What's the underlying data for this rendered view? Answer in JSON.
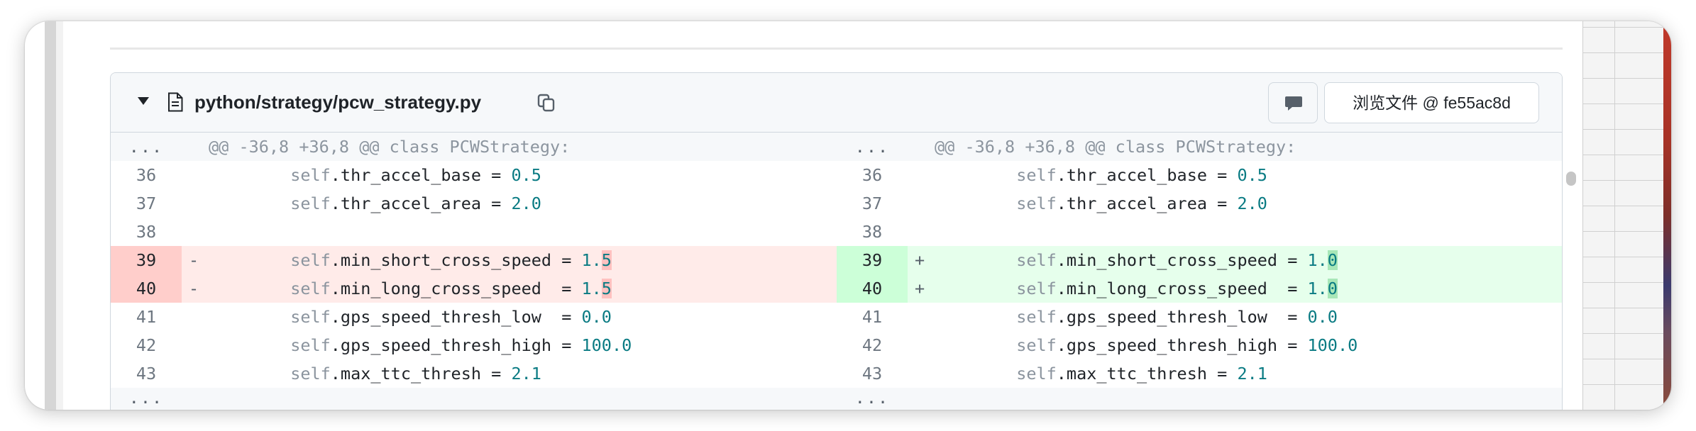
{
  "file": {
    "path": "python/strategy/pcw_strategy.py",
    "view_file_label": "浏览文件 @ fe55ac8d"
  },
  "icons": {
    "collapse": "chevron-down-icon",
    "file": "file-icon",
    "copy": "copy-icon",
    "comment": "comment-icon"
  },
  "diff": {
    "hunk_header": "@@ -36,8 +36,8 @@ class PCWStrategy:",
    "expander": "...",
    "rows": [
      {
        "type": "ctx",
        "left_num": "36",
        "right_num": "36",
        "indent": "        ",
        "self": "self",
        "attr": ".thr_accel_base = ",
        "left_val": "0.5",
        "right_val": "0.5"
      },
      {
        "type": "ctx",
        "left_num": "37",
        "right_num": "37",
        "indent": "        ",
        "self": "self",
        "attr": ".thr_accel_area = ",
        "left_val": "2.0",
        "right_val": "2.0"
      },
      {
        "type": "ctx",
        "left_num": "38",
        "right_num": "38",
        "indent": "",
        "self": "",
        "attr": "",
        "left_val": "",
        "right_val": ""
      },
      {
        "type": "change",
        "left_num": "39",
        "right_num": "39",
        "left_marker": "-",
        "right_marker": "+",
        "indent": "        ",
        "self": "self",
        "attr": ".min_short_cross_speed = ",
        "left_val_a": "1.",
        "left_val_b": "5",
        "right_val_a": "1.",
        "right_val_b": "0"
      },
      {
        "type": "change",
        "left_num": "40",
        "right_num": "40",
        "left_marker": "-",
        "right_marker": "+",
        "indent": "        ",
        "self": "self",
        "attr": ".min_long_cross_speed  = ",
        "left_val_a": "1.",
        "left_val_b": "5",
        "right_val_a": "1.",
        "right_val_b": "0"
      },
      {
        "type": "ctx",
        "left_num": "41",
        "right_num": "41",
        "indent": "        ",
        "self": "self",
        "attr": ".gps_speed_thresh_low  = ",
        "left_val": "0.0",
        "right_val": "0.0"
      },
      {
        "type": "ctx",
        "left_num": "42",
        "right_num": "42",
        "indent": "        ",
        "self": "self",
        "attr": ".gps_speed_thresh_high = ",
        "left_val": "100.0",
        "right_val": "100.0"
      },
      {
        "type": "ctx",
        "left_num": "43",
        "right_num": "43",
        "indent": "        ",
        "self": "self",
        "attr": ".max_ttc_thresh = ",
        "left_val": "2.1",
        "right_val": "2.1"
      }
    ]
  },
  "colors": {
    "deleted_bg": "#ffebe9",
    "deleted_num_bg": "#ffcecb",
    "added_bg": "#e6ffec",
    "added_num_bg": "#ccffd8",
    "number_token": "#0a7b83"
  }
}
